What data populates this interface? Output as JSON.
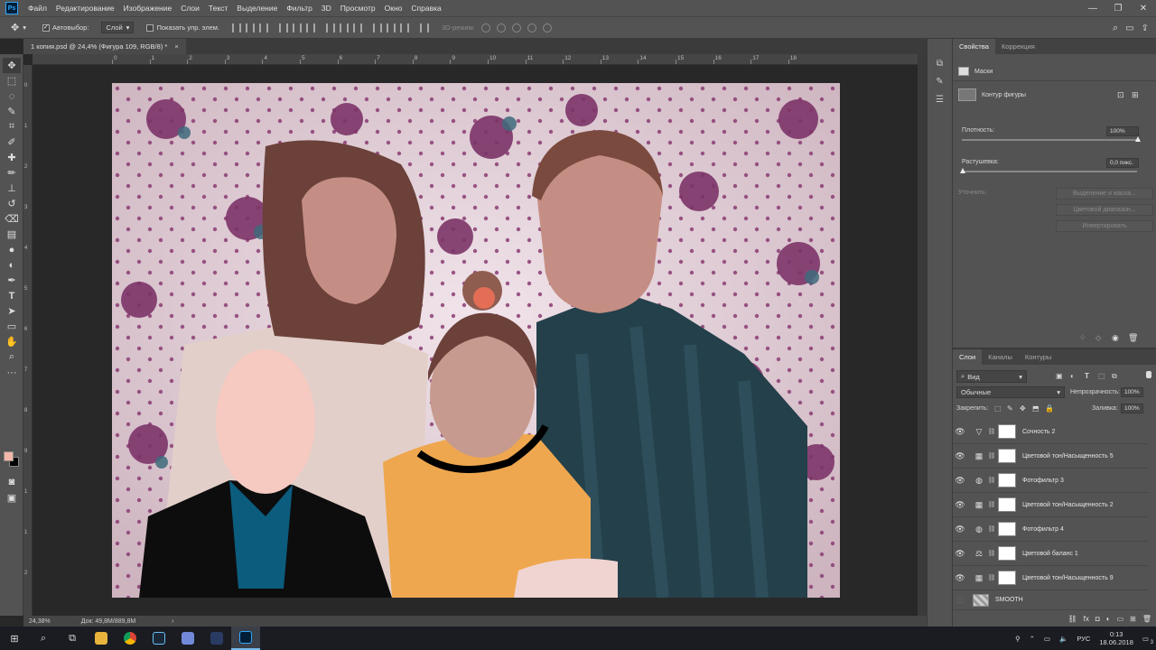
{
  "menubar": {
    "logo": "Ps",
    "items": [
      "Файл",
      "Редактирование",
      "Изображение",
      "Слои",
      "Текст",
      "Выделение",
      "Фильтр",
      "3D",
      "Просмотр",
      "Окно",
      "Справка"
    ]
  },
  "options": {
    "autoselect_label": "Автовыбор:",
    "autoselect_value": "Слой",
    "show_controls_label": "Показать упр. элем.",
    "mode3d_label": "3D-режим:"
  },
  "document": {
    "tab_title": "1 копия.psd @ 24,4% (Фигура 109, RGB/8) *",
    "ruler_labels": [
      "0",
      "1",
      "2",
      "3",
      "4",
      "5",
      "6",
      "7",
      "8",
      "9",
      "10",
      "11",
      "12",
      "13",
      "14",
      "15",
      "16",
      "17",
      "18"
    ],
    "vruler_labels": [
      "0",
      "1",
      "2",
      "3",
      "4",
      "5",
      "6",
      "7",
      "8",
      "9",
      "1",
      "1",
      "2"
    ]
  },
  "status": {
    "zoom": "24,38%",
    "doc_info": "Док: 49,8M/889,8M"
  },
  "properties": {
    "tabs": [
      "Свойства",
      "Коррекция"
    ],
    "section_title": "Маски",
    "shape_label": "Контур фигуры",
    "density_label": "Плотность:",
    "density_value": "100%",
    "feather_label": "Растушевка:",
    "feather_value": "0,0 пикс.",
    "refine_label": "Уточнить:",
    "btn_select_mask": "Выделение и маска...",
    "btn_color_range": "Цветовой диапазон...",
    "btn_invert": "Инвертировать"
  },
  "layers": {
    "tabs": [
      "Слои",
      "Каналы",
      "Контуры"
    ],
    "filter_label": "Вид",
    "blend_mode": "Обычные",
    "opacity_label": "Непрозрачность:",
    "opacity_value": "100%",
    "lock_label": "Закрепить:",
    "fill_label": "Заливка:",
    "fill_value": "100%",
    "items": [
      {
        "name": "Сочность 2",
        "icon": "vibrance-icon"
      },
      {
        "name": "Цветовой тон/Насыщенность 5",
        "icon": "hue-saturation-icon"
      },
      {
        "name": "Фотофильтр 3",
        "icon": "photo-filter-icon"
      },
      {
        "name": "Цветовой тон/Насыщенность 2",
        "icon": "hue-saturation-icon"
      },
      {
        "name": "Фотофильтр 4",
        "icon": "photo-filter-icon"
      },
      {
        "name": "Цветовой баланс 1",
        "icon": "color-balance-icon"
      },
      {
        "name": "Цветовой тон/Насыщенность 9",
        "icon": "hue-saturation-icon"
      },
      {
        "name": "SMOOTH",
        "icon": "smart-object-icon"
      }
    ]
  },
  "taskbar": {
    "language": "РУС",
    "time": "0:13",
    "date": "18.06.2018",
    "notifications": "3"
  },
  "colors": {
    "foreground": "#f2b7a8",
    "background": "#000000",
    "ui_panel": "#535353",
    "ui_dark": "#282828"
  }
}
